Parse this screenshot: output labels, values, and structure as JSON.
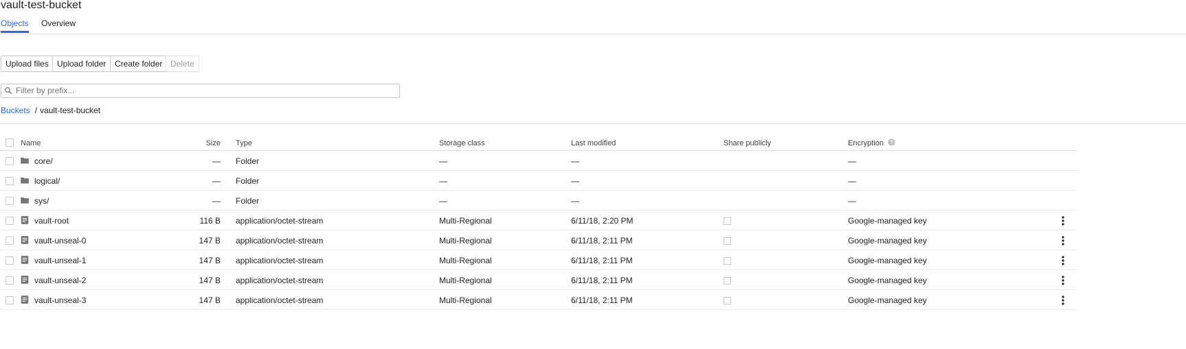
{
  "page": {
    "title": "vault-test-bucket"
  },
  "tabs": [
    {
      "label": "Objects",
      "active": true
    },
    {
      "label": "Overview",
      "active": false
    }
  ],
  "toolbar": {
    "upload_files": "Upload files",
    "upload_folder": "Upload folder",
    "create_folder": "Create folder",
    "delete": "Delete"
  },
  "filter": {
    "placeholder": "Filter by prefix...",
    "value": ""
  },
  "breadcrumb": {
    "root": "Buckets",
    "separator": "/",
    "current": "vault-test-bucket"
  },
  "table": {
    "headers": {
      "name": "Name",
      "size": "Size",
      "type": "Type",
      "storage_class": "Storage class",
      "last_modified": "Last modified",
      "share_publicly": "Share publicly",
      "encryption": "Encryption"
    },
    "rows": [
      {
        "kind": "folder",
        "icon": "folder-icon",
        "name": "core/",
        "size": "—",
        "type": "Folder",
        "storage_class": "—",
        "last_modified": "—",
        "encryption": "—"
      },
      {
        "kind": "folder",
        "icon": "folder-icon",
        "name": "logical/",
        "size": "—",
        "type": "Folder",
        "storage_class": "—",
        "last_modified": "—",
        "encryption": "—"
      },
      {
        "kind": "folder",
        "icon": "folder-icon",
        "name": "sys/",
        "size": "—",
        "type": "Folder",
        "storage_class": "—",
        "last_modified": "—",
        "encryption": "—"
      },
      {
        "kind": "file",
        "icon": "file-icon",
        "name": "vault-root",
        "size": "116 B",
        "type": "application/octet-stream",
        "storage_class": "Multi-Regional",
        "last_modified": "6/11/18, 2:20 PM",
        "encryption": "Google-managed key"
      },
      {
        "kind": "file",
        "icon": "file-icon",
        "name": "vault-unseal-0",
        "size": "147 B",
        "type": "application/octet-stream",
        "storage_class": "Multi-Regional",
        "last_modified": "6/11/18, 2:11 PM",
        "encryption": "Google-managed key"
      },
      {
        "kind": "file",
        "icon": "file-icon",
        "name": "vault-unseal-1",
        "size": "147 B",
        "type": "application/octet-stream",
        "storage_class": "Multi-Regional",
        "last_modified": "6/11/18, 2:11 PM",
        "encryption": "Google-managed key"
      },
      {
        "kind": "file",
        "icon": "file-icon",
        "name": "vault-unseal-2",
        "size": "147 B",
        "type": "application/octet-stream",
        "storage_class": "Multi-Regional",
        "last_modified": "6/11/18, 2:11 PM",
        "encryption": "Google-managed key"
      },
      {
        "kind": "file",
        "icon": "file-icon",
        "name": "vault-unseal-3",
        "size": "147 B",
        "type": "application/octet-stream",
        "storage_class": "Multi-Regional",
        "last_modified": "6/11/18, 2:11 PM",
        "encryption": "Google-managed key"
      }
    ]
  },
  "colors": {
    "accent": "#3367d6",
    "icon_gray": "#757575",
    "divider": "#dadce0"
  }
}
